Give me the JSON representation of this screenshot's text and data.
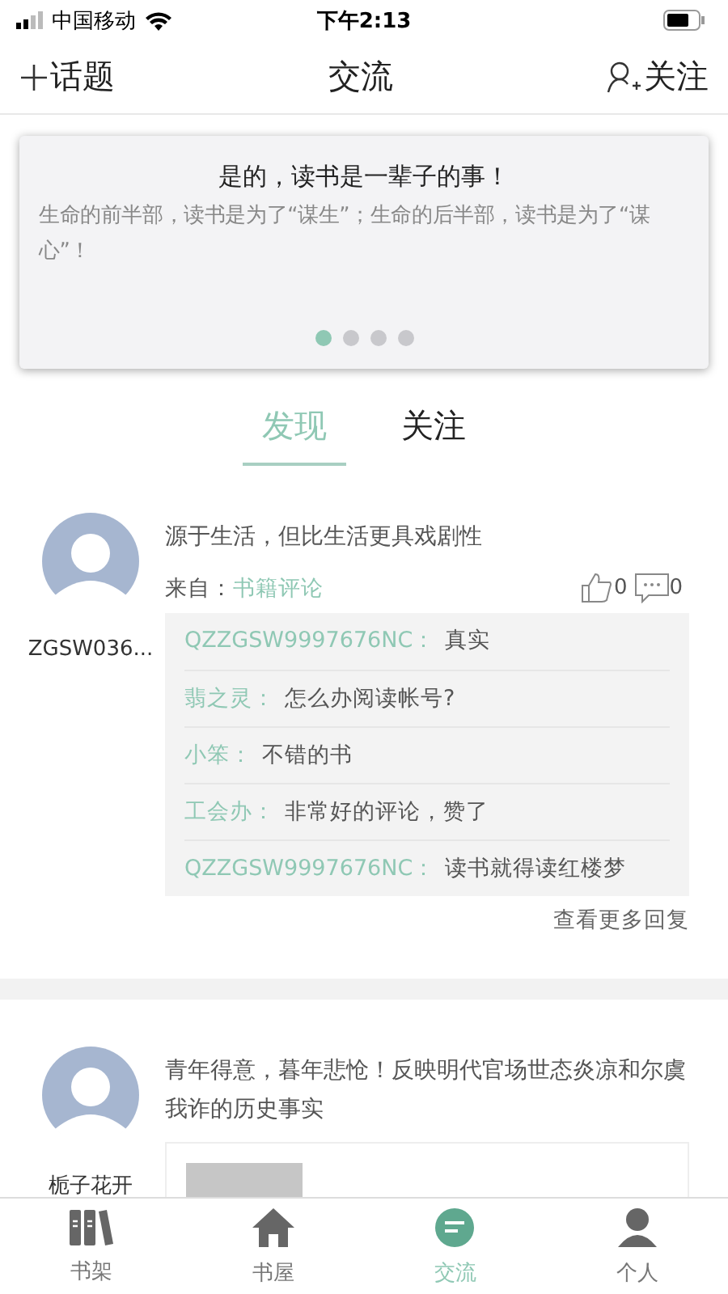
{
  "status_bar": {
    "carrier": "中国移动",
    "time": "下午2:13"
  },
  "nav": {
    "left": "话题",
    "title": "交流",
    "right": "关注"
  },
  "banner": {
    "title": "是的，读书是一辈子的事！",
    "body": "生命的前半部，读书是为了“谋生”；生命的后半部，读书是为了“谋心”！",
    "dots": [
      {
        "selected": true
      },
      {
        "selected": false
      },
      {
        "selected": false
      },
      {
        "selected": false
      }
    ]
  },
  "tabs": [
    {
      "label": "发现",
      "selected": true
    },
    {
      "label": "关注",
      "selected": false
    }
  ],
  "posts": [
    {
      "user": "ZGSW036...",
      "text": "源于生活，但比生活更具戏剧性",
      "source_label": "来自：",
      "source": "书籍评论",
      "likes": "0",
      "comments": "0",
      "replies": [
        {
          "name": "QZZGSW9997676NC：",
          "text": "真实"
        },
        {
          "name": "翡之灵：",
          "text": "怎么办阅读帐号?"
        },
        {
          "name": "小笨：",
          "text": "不错的书"
        },
        {
          "name": "工会办：",
          "text": "非常好的评论，赞了"
        },
        {
          "name": "QZZGSW9997676NC：",
          "text": "读书就得读红楼梦"
        }
      ],
      "more": "查看更多回复"
    },
    {
      "user": "栀子花开",
      "text": "青年得意，暮年悲怆！反映明代官场世态炎凉和尔虞我诈的历史事实",
      "book_card": true
    }
  ],
  "tab_bar": [
    {
      "label": "书架",
      "kind": "shelf",
      "selected": false
    },
    {
      "label": "书屋",
      "kind": "house",
      "selected": false
    },
    {
      "label": "交流",
      "kind": "chat",
      "selected": true
    },
    {
      "label": "个人",
      "kind": "person",
      "selected": false
    }
  ]
}
